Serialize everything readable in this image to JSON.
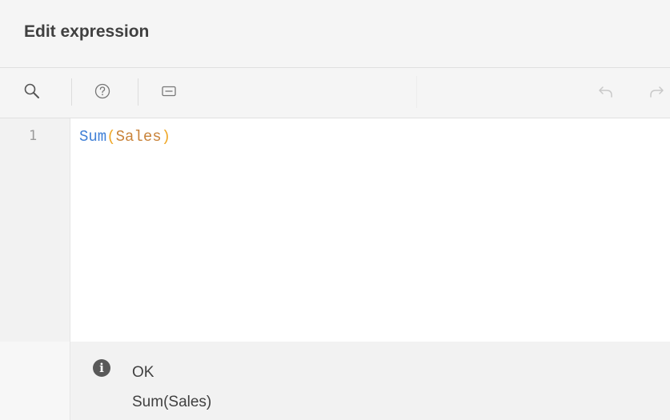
{
  "dialog": {
    "title": "Edit expression"
  },
  "toolbar": {
    "buttons": [
      {
        "icon": "search-icon"
      },
      {
        "icon": "help-icon"
      },
      {
        "icon": "comment-icon"
      },
      {
        "icon": "undo-icon"
      },
      {
        "icon": "redo-icon"
      }
    ]
  },
  "editor": {
    "line_number": "1",
    "tokens": {
      "func": "Sum",
      "open_paren": "(",
      "field": "Sales",
      "close_paren": ")"
    }
  },
  "status": {
    "icon": "info-icon",
    "icon_glyph": "i",
    "title": "OK",
    "expression": "Sum(Sales)"
  },
  "colors": {
    "function": "#3f7fd6",
    "paren": "#f0a92a",
    "field": "#c9833a"
  }
}
